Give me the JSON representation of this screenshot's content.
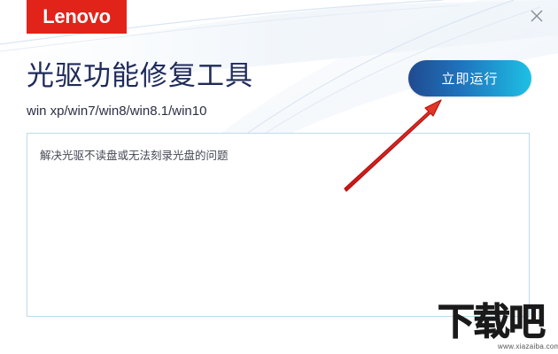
{
  "app": {
    "logo_text": "Lenovo",
    "title": "光驱功能修复工具",
    "subtitle": "win xp/win7/win8/win8.1/win10"
  },
  "actions": {
    "run_label": "立即运行"
  },
  "description": {
    "text": "解决光驱不读盘或无法刻录光盘的问题"
  },
  "watermark": {
    "main": "下载吧",
    "url": "www.xiazaiba.com"
  },
  "icons": {
    "close": "close-icon"
  },
  "colors": {
    "brand_red": "#e2231a",
    "title_navy": "#1f2a5a",
    "button_gradient_start": "#214a8f",
    "button_gradient_end": "#1ec0e4",
    "box_border": "#bcdcec",
    "annotation_arrow": "#d42020"
  }
}
